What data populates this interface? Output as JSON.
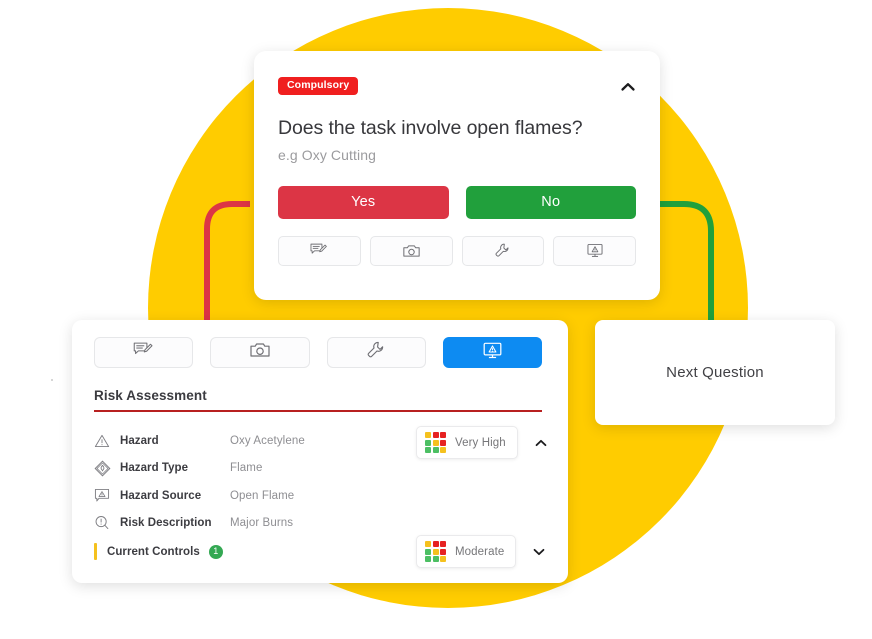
{
  "theme": {
    "brand_yellow": "#FFCC00",
    "yes_red": "#DC3545",
    "no_green": "#21A03C",
    "active_blue": "#0D8BF2",
    "badge_red": "#F01F1F",
    "rule_red": "#B82020",
    "control_green": "#34A853",
    "control_bar_yellow": "#F5C11E"
  },
  "question_card": {
    "badge": "Compulsory",
    "collapse_icon": "chevron-up-icon",
    "title": "Does the task involve open flames?",
    "subtitle": "e.g Oxy Cutting",
    "answers": [
      {
        "label": "Yes",
        "color": "#DC3545"
      },
      {
        "label": "No",
        "color": "#21A03C"
      }
    ],
    "tools": [
      {
        "icon": "comment-edit-icon"
      },
      {
        "icon": "camera-icon"
      },
      {
        "icon": "wrench-icon"
      },
      {
        "icon": "monitor-hazard-icon"
      }
    ]
  },
  "risk_card": {
    "tabs": [
      {
        "icon": "comment-edit-icon",
        "active": false
      },
      {
        "icon": "camera-icon",
        "active": false
      },
      {
        "icon": "wrench-icon",
        "active": false
      },
      {
        "icon": "monitor-hazard-icon",
        "active": true
      }
    ],
    "section_title": "Risk Assessment",
    "rows": [
      {
        "icon": "warning-triangle-icon",
        "label": "Hazard",
        "value": "Oxy Acetylene"
      },
      {
        "icon": "flame-diamond-icon",
        "label": "Hazard Type",
        "value": "Flame"
      },
      {
        "icon": "hazard-comment-icon",
        "label": "Hazard Source",
        "value": "Open Flame"
      },
      {
        "icon": "exclamation-search-icon",
        "label": "Risk Description",
        "value": "Major Burns"
      }
    ],
    "risk_rating": {
      "label": "Very High",
      "chevron": "chevron-up-icon",
      "matrix": [
        [
          "#F5C11E",
          "#E62222",
          "#E62222"
        ],
        [
          "#4CBF63",
          "#F5C11E",
          "#E62222"
        ],
        [
          "#4CBF63",
          "#4CBF63",
          "#F5C11E"
        ]
      ]
    },
    "current_controls": {
      "label": "Current Controls",
      "count": "1",
      "rating_label": "Moderate",
      "chevron": "chevron-down-icon",
      "matrix": [
        [
          "#F5C11E",
          "#E62222",
          "#E62222"
        ],
        [
          "#4CBF63",
          "#F5C11E",
          "#E62222"
        ],
        [
          "#4CBF63",
          "#4CBF63",
          "#F5C11E"
        ]
      ]
    }
  },
  "next_card": {
    "label": "Next Question"
  }
}
